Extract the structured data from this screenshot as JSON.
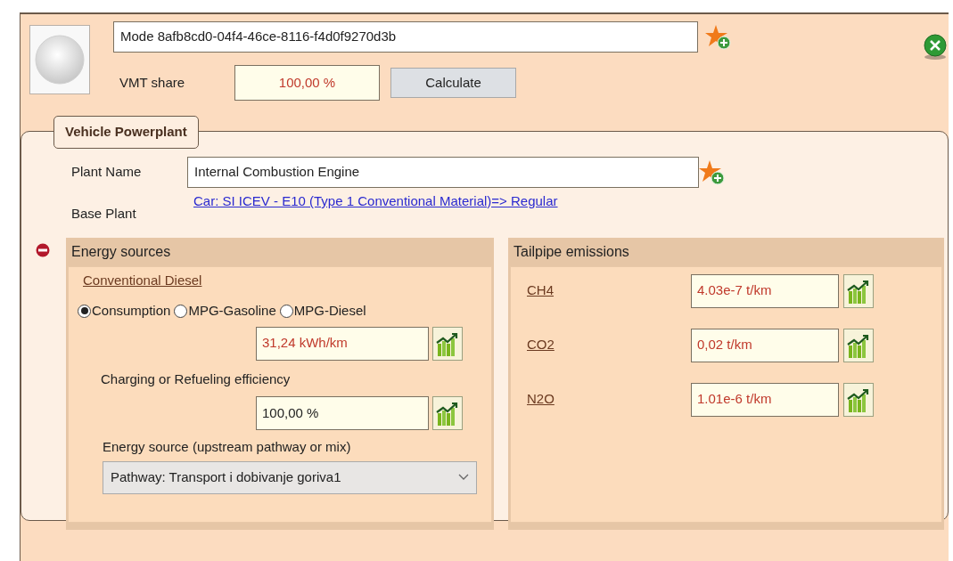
{
  "mode": {
    "name": "Mode 8afb8cd0-04f4-46ce-8116-f4d0f9270d3b",
    "vmt_label": "VMT share",
    "vmt_share": {
      "value": "100,00 %",
      "overridden": true
    },
    "calculate_button": "Calculate"
  },
  "powerplant": {
    "title": "Vehicle Powerplant",
    "plant_name_label": "Plant Name",
    "plant_name": "Internal Combustion Engine",
    "base_plant_label": "Base Plant",
    "base_plant_link": "Car: SI ICEV - E10 (Type 1 Conventional Material)=> Regular",
    "energy_sources": {
      "title": "Energy sources",
      "fuel_link": "Conventional Diesel",
      "radios": [
        {
          "label": "Consumption",
          "selected": true
        },
        {
          "label": "MPG-Gasoline",
          "selected": false
        },
        {
          "label": "MPG-Diesel",
          "selected": false
        }
      ],
      "consumption": {
        "value": "31,24 kWh/km",
        "overridden": true
      },
      "efficiency_label": "Charging or Refueling efficiency",
      "efficiency": {
        "value": "100,00 %",
        "overridden": false
      },
      "source_label": "Energy source (upstream pathway or mix)",
      "source_select": "Pathway: Transport i dobivanje goriva1"
    },
    "tailpipe": {
      "title": "Tailpipe emissions",
      "rows": [
        {
          "gas": "CH4",
          "value": "4.03e-7 t/km",
          "overridden": true
        },
        {
          "gas": "CO2",
          "value": "0,02 t/km",
          "overridden": true
        },
        {
          "gas": "N2O",
          "value": "1.01e-6 t/km",
          "overridden": true
        }
      ]
    }
  }
}
